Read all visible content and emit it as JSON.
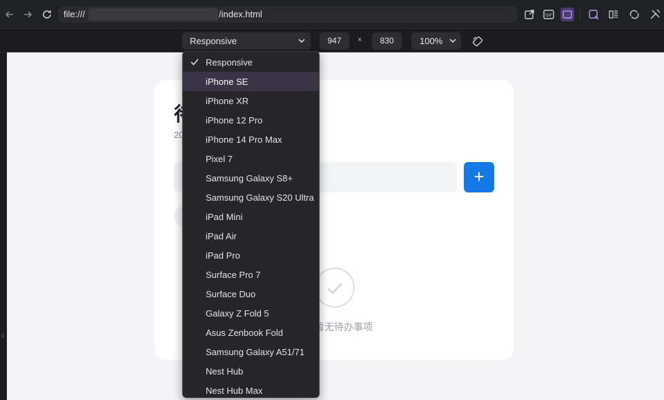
{
  "browser": {
    "url_prefix": "file:///",
    "url_suffix": "/index.html",
    "icons": [
      "back-arrow-icon",
      "forward-arrow-icon",
      "reload-icon",
      "open-external-icon",
      "gif-record-icon",
      "responsive-mode-icon",
      "screenshot-icon",
      "reader-icon",
      "sync-icon",
      "tools-icon"
    ]
  },
  "device_toolbar": {
    "device": "Responsive",
    "width": "947",
    "times": "×",
    "height": "830",
    "zoom": "100%"
  },
  "app": {
    "title": "待办",
    "date": "20",
    "add_button": "+",
    "empty_text": "暂无待办事项",
    "accent": "#1677e6"
  },
  "dropdown": {
    "selected": "Responsive",
    "highlighted": "iPhone SE",
    "items": [
      "Responsive",
      "iPhone SE",
      "iPhone XR",
      "iPhone 12 Pro",
      "iPhone 14 Pro Max",
      "Pixel 7",
      "Samsung Galaxy S8+",
      "Samsung Galaxy S20 Ultra",
      "iPad Mini",
      "iPad Air",
      "iPad Pro",
      "Surface Pro 7",
      "Surface Duo",
      "Galaxy Z Fold 5",
      "Asus Zenbook Fold",
      "Samsung Galaxy A51/71",
      "Nest Hub",
      "Nest Hub Max"
    ]
  }
}
